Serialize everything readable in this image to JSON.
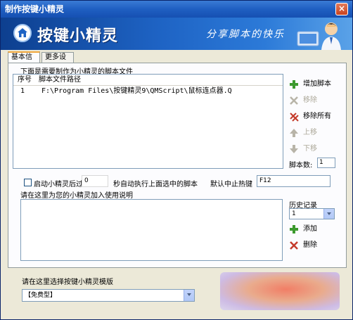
{
  "window": {
    "title": "制作按键小精灵",
    "close_glyph": "×"
  },
  "banner": {
    "title": "按键小精灵",
    "slogan": "分享脚本的快乐"
  },
  "tabs": [
    {
      "label": "基本信息",
      "active": true
    },
    {
      "label": "更多设置",
      "active": false
    }
  ],
  "scripts": {
    "group_label": "下面是需要制作为小精灵的脚本文件",
    "columns": {
      "index": "序号",
      "path": "脚本文件路径"
    },
    "rows": [
      {
        "index": "1",
        "path": "F:\\Program Files\\按键精灵9\\QMScript\\鼠标连点器.Q"
      }
    ],
    "count_label": "脚本数:",
    "count_value": "1"
  },
  "side_buttons": {
    "add": {
      "label": "增加脚本",
      "icon": "plus-icon",
      "color": "#3c9a2e"
    },
    "remove": {
      "label": "移除",
      "icon": "x-icon",
      "disabled": true
    },
    "remove_all": {
      "label": "移除所有",
      "icon": "remove-all-icon",
      "color": "#c43a2a"
    },
    "move_up": {
      "label": "上移",
      "icon": "arrow-up-icon",
      "disabled": true
    },
    "move_down": {
      "label": "下移",
      "icon": "arrow-down-icon",
      "disabled": true
    }
  },
  "options": {
    "autostart_label": "启动小精灵后过",
    "autostart_checked": false,
    "delay_value": "0",
    "delay_suffix": "秒自动执行上面选中的脚本",
    "hotkey_label": "默认中止热键",
    "hotkey_value": "F12"
  },
  "description": {
    "label": "请在这里为您的小精灵加入使用说明",
    "value": ""
  },
  "history": {
    "label": "历史记录",
    "selected": "1",
    "add_label": "添加",
    "delete_label": "删除"
  },
  "template": {
    "label": "请在这里选择按键小精灵模版",
    "selected": "【免费型】"
  },
  "colors": {
    "titlebar": "#1f5fc2",
    "banner": "#1e63c4",
    "window_bg": "#ece9d8",
    "accent_orange": "#f0a63a"
  }
}
